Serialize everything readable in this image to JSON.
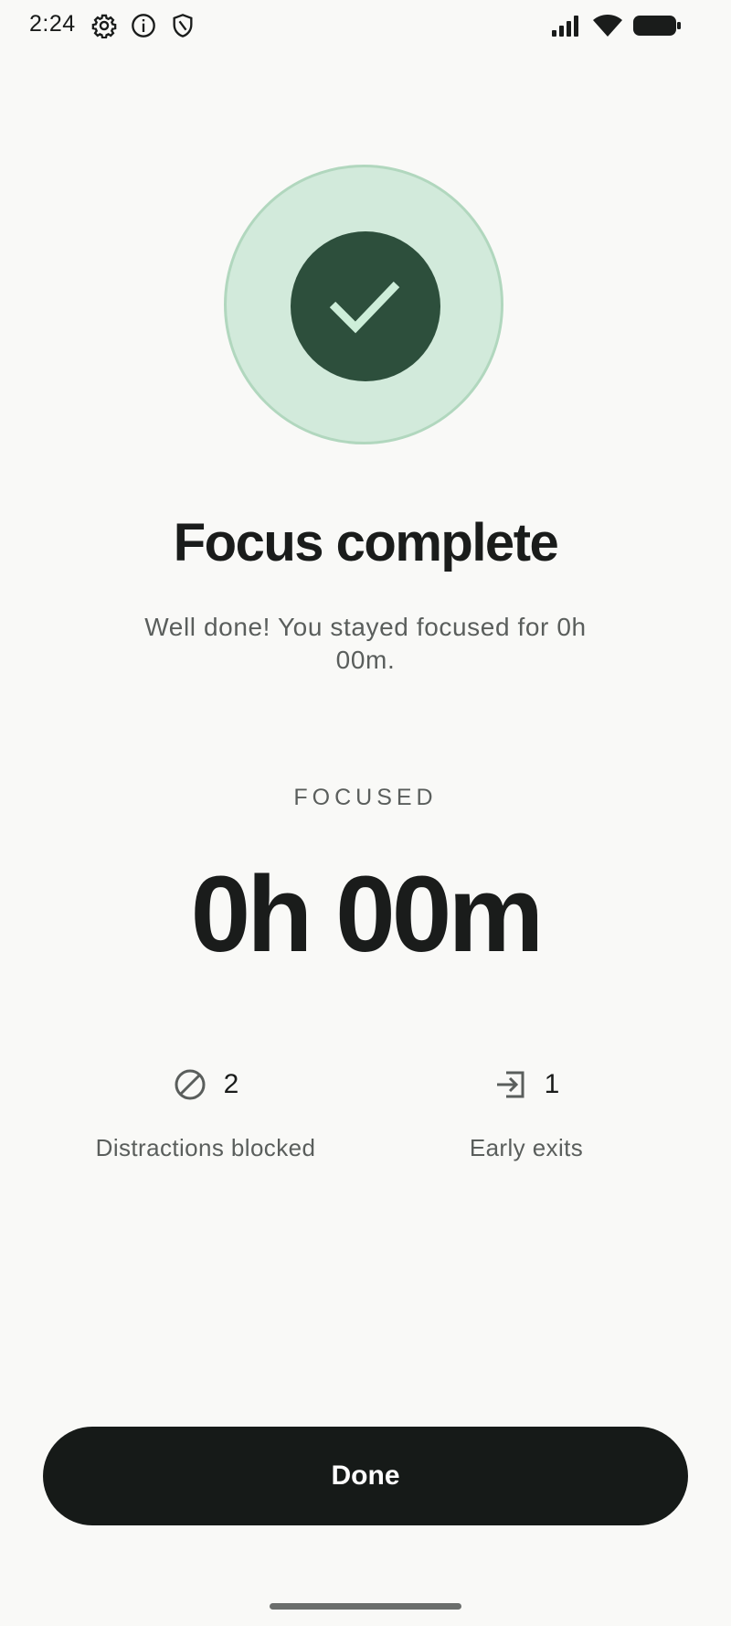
{
  "status_bar": {
    "time": "2:24",
    "left_icons": [
      "gear-icon",
      "info-icon",
      "shield-icon"
    ],
    "right_icons": [
      "signal-icon",
      "wifi-icon",
      "battery-icon"
    ]
  },
  "badge": {
    "icon": "check-icon",
    "outer_color": "#d2eadb",
    "inner_color": "#2d4f3c"
  },
  "title": "Focus complete",
  "subtitle": "Well done! You stayed focused for 0h 00m.",
  "focused": {
    "label": "FOCUSED",
    "value": "0h 00m"
  },
  "stats": [
    {
      "icon": "block-icon",
      "value": "2",
      "label": "Distractions blocked"
    },
    {
      "icon": "exit-icon",
      "value": "1",
      "label": "Early exits"
    }
  ],
  "done_button": {
    "label": "Done"
  }
}
